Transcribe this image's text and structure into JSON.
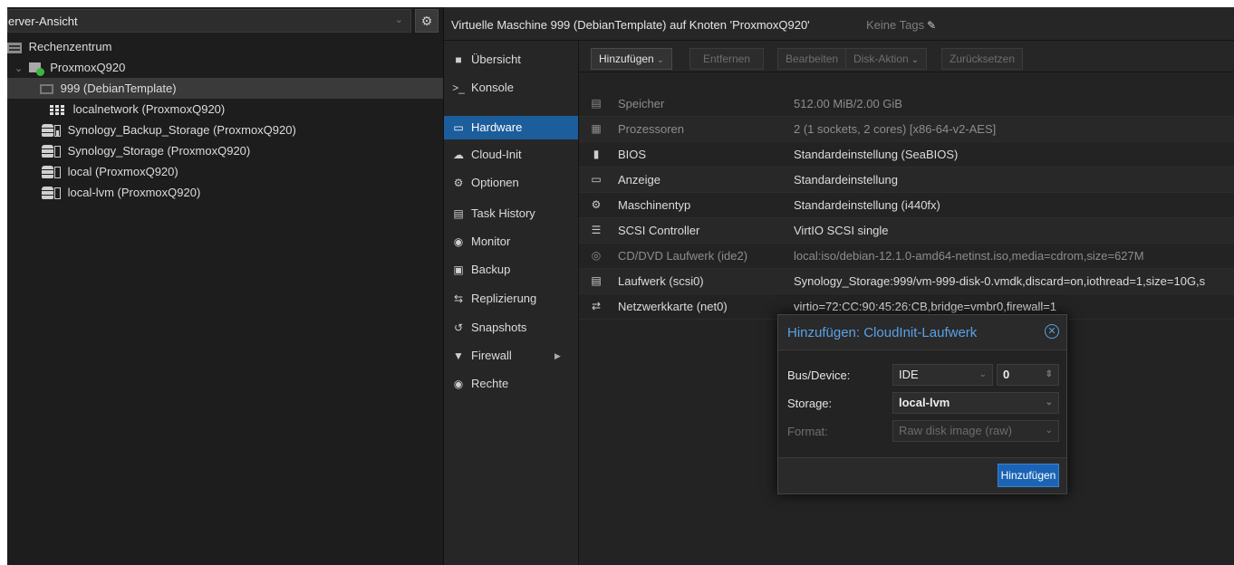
{
  "view_select": {
    "label": "erver-Ansicht"
  },
  "tree": {
    "datacenter": "Rechenzentrum",
    "node": "ProxmoxQ920",
    "items": [
      {
        "label": "999 (DebianTemplate)"
      },
      {
        "label": "localnetwork (ProxmoxQ920)"
      },
      {
        "label": "Synology_Backup_Storage (ProxmoxQ920)"
      },
      {
        "label": "Synology_Storage (ProxmoxQ920)"
      },
      {
        "label": "local (ProxmoxQ920)"
      },
      {
        "label": "local-lvm (ProxmoxQ920)"
      }
    ]
  },
  "header": {
    "title": "Virtuelle Maschine 999 (DebianTemplate) auf Knoten 'ProxmoxQ920'",
    "tags": "Keine Tags"
  },
  "nav": {
    "items": [
      {
        "label": "Übersicht",
        "icon": "book-icon"
      },
      {
        "label": "Konsole",
        "icon": "terminal-icon"
      },
      {
        "label": "Hardware",
        "icon": "desktop-icon"
      },
      {
        "label": "Cloud-Init",
        "icon": "cloud-icon"
      },
      {
        "label": "Optionen",
        "icon": "gear-icon"
      },
      {
        "label": "Task History",
        "icon": "list-icon"
      },
      {
        "label": "Monitor",
        "icon": "eye-icon"
      },
      {
        "label": "Backup",
        "icon": "floppy-icon"
      },
      {
        "label": "Replizierung",
        "icon": "retweet-icon"
      },
      {
        "label": "Snapshots",
        "icon": "history-icon"
      },
      {
        "label": "Firewall",
        "icon": "shield-icon"
      },
      {
        "label": "Rechte",
        "icon": "unlock-icon"
      }
    ]
  },
  "toolbar": {
    "add": "Hinzufügen",
    "remove": "Entfernen",
    "edit": "Bearbeiten",
    "disk_action": "Disk-Aktion",
    "revert": "Zurücksetzen"
  },
  "hardware": [
    {
      "key": "Speicher",
      "value": "512.00 MiB/2.00 GiB",
      "icon": "memory-icon",
      "pending": true
    },
    {
      "key": "Prozessoren",
      "value": "2 (1 sockets, 2 cores) [x86-64-v2-AES]",
      "icon": "cpu-icon",
      "pending": true
    },
    {
      "key": "BIOS",
      "value": "Standardeinstellung (SeaBIOS)",
      "icon": "microchip-icon",
      "pending": false
    },
    {
      "key": "Anzeige",
      "value": "Standardeinstellung",
      "icon": "display-icon",
      "pending": false
    },
    {
      "key": "Maschinentyp",
      "value": "Standardeinstellung (i440fx)",
      "icon": "cogs-icon",
      "pending": false
    },
    {
      "key": "SCSI Controller",
      "value": "VirtIO SCSI single",
      "icon": "database-icon",
      "pending": false
    },
    {
      "key": "CD/DVD Laufwerk (ide2)",
      "value": "local:iso/debian-12.1.0-amd64-netinst.iso,media=cdrom,size=627M",
      "icon": "cdrom-icon",
      "pending": true
    },
    {
      "key": "Laufwerk (scsi0)",
      "value": "Synology_Storage:999/vm-999-disk-0.vmdk,discard=on,iothread=1,size=10G,s",
      "icon": "hdd-icon",
      "pending": false
    },
    {
      "key": "Netzwerkkarte (net0)",
      "value": "virtio=72:CC:90:45:26:CB,bridge=vmbr0,firewall=1",
      "icon": "exchange-icon",
      "pending": false
    }
  ],
  "dialog": {
    "title": "Hinzufügen: CloudInit-Laufwerk",
    "bus_label": "Bus/Device:",
    "bus_value": "IDE",
    "device_number": "0",
    "storage_label": "Storage:",
    "storage_value": "local-lvm",
    "format_label": "Format:",
    "format_value": "Raw disk image (raw)",
    "ok_button": "Hinzufügen"
  },
  "colors": {
    "accent": "#1c5d9c",
    "dialog_title": "#5aa1e6",
    "button_primary": "#1b64b5"
  }
}
